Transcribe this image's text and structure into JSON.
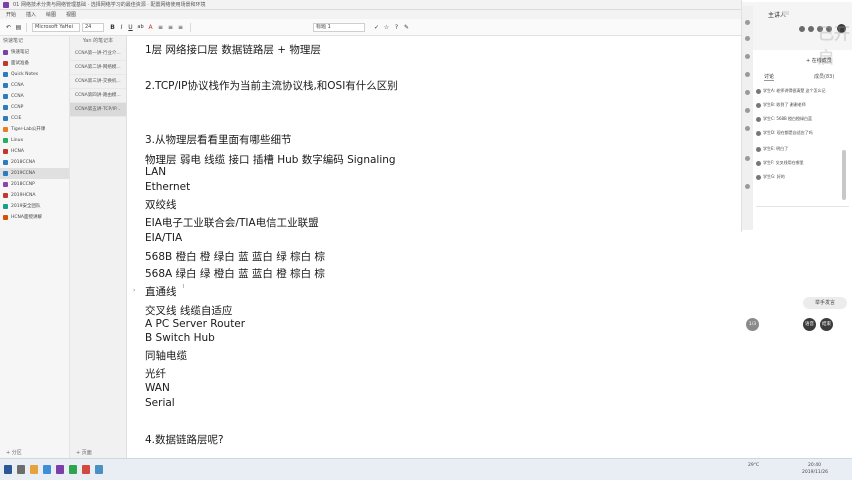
{
  "window": {
    "title": "01 网络技术分类与网络管理基础 · 选择网络学习的最佳资源 · 配置网络使用场景和环境",
    "ribbon_tabs": [
      "开始",
      "插入",
      "绘图",
      "视图"
    ]
  },
  "toolbar": {
    "font_name": "Microsoft YaHei",
    "font_size": "24",
    "style": "标题 1",
    "buttons": [
      "B",
      "I",
      "U",
      "ab",
      "A",
      "≡",
      "≡",
      "≡",
      "✓",
      "☆",
      "?",
      "✎"
    ]
  },
  "notebooks": {
    "header": "快速笔记",
    "items": [
      {
        "label": "快速笔记",
        "color": "#7b3fa8"
      },
      {
        "label": "面试准备",
        "color": "#c0392b"
      },
      {
        "label": "Quick Notes",
        "color": "#2c7cc0"
      },
      {
        "label": "CCNA",
        "color": "#2c7cc0"
      },
      {
        "label": "CCNA",
        "color": "#2c7cc0"
      },
      {
        "label": "CCNP",
        "color": "#2c7cc0"
      },
      {
        "label": "CCIE",
        "color": "#2c7cc0"
      },
      {
        "label": "Tiger-Lab公开课",
        "color": "#e67e22"
      },
      {
        "label": "Linux",
        "color": "#27ae60"
      },
      {
        "label": "HCNA",
        "color": "#c0392b"
      },
      {
        "label": "2018CCNA",
        "color": "#2c7cc0"
      },
      {
        "label": "2019CCNA",
        "color": "#2c7cc0"
      },
      {
        "label": "2018CCNP",
        "color": "#8e44ad"
      },
      {
        "label": "2019HCNA",
        "color": "#c0392b"
      },
      {
        "label": "2019安全团队",
        "color": "#16a085"
      },
      {
        "label": "HCNA面授讲解",
        "color": "#d35400"
      }
    ],
    "selected_index": 11,
    "add_label": "+ 分区"
  },
  "sections": {
    "header": "Yan 的笔记本",
    "items": [
      "CCNA第一讲-行业介...",
      "CCNA第二讲-网络模...",
      "CCNA第三讲-交换机...",
      "CCNA第四讲-路由模...",
      "CCNA第五讲-TCP/IP..."
    ],
    "selected_index": 4,
    "add_label": "+ 页面"
  },
  "page": {
    "lines": [
      "1层 网络接口层       数据链路层 + 物理层",
      "2.TCP/IP协议栈作为当前主流协议栈,和OSI有什么区别",
      "3.从物理层看看里面有哪些细节",
      "物理层 弱电 线缆 接口  插槽  Hub 数字编码 Signaling",
      "LAN",
      "Ethernet",
      "双绞线",
      "EIA电子工业联合会/TIA电信工业联盟",
      "EIA/TIA",
      "568B  橙白 橙 绿白 蓝 蓝白 绿 棕白 棕",
      "568A  绿白 绿 橙白 蓝 蓝白 橙 棕白 棕",
      "直通线",
      "交叉线   线缆自适应",
      "A PC Server Router",
      "B Switch Hub",
      "同轴电缆",
      "光纤",
      "WAN",
      "Serial",
      "4.数据链路层呢?"
    ]
  },
  "call": {
    "host": "主讲人",
    "watermark": "已开启",
    "title": "+ 在线成员",
    "tabs": [
      "讨论",
      "成员(83)"
    ],
    "messages": [
      "学生A: 老师讲得很清楚 这个怎么记",
      "学生B: 收到了 谢谢老师",
      "学生C: 568B 橙白橙绿白蓝",
      "学生D: 现在都是自适应了吗",
      "学生E: 明白了",
      "学生F: 交叉线用在哪里",
      "学生G: 好的"
    ]
  },
  "floating": {
    "pill_label": "举手发言",
    "circle_left": "1/3",
    "circle_mid": "语音",
    "circle_right": "结束"
  },
  "taskbar": {
    "weather": "29°C",
    "time": "20:40",
    "date": "2019/11/26"
  }
}
